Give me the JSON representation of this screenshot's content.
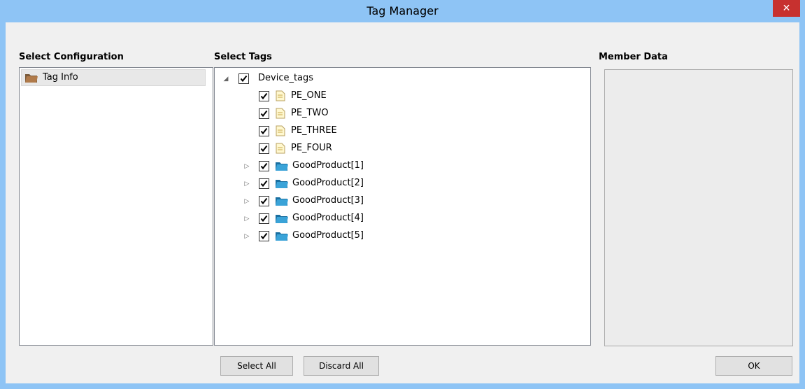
{
  "window": {
    "title": "Tag Manager",
    "close_glyph": "✕"
  },
  "labels": {
    "select_configuration": "Select Configuration",
    "select_tags": "Select Tags",
    "member_data": "Member Data"
  },
  "configuration": {
    "items": [
      {
        "label": "Tag Info",
        "icon": "folder-icon"
      }
    ]
  },
  "tree": {
    "root": {
      "label": "Device_tags",
      "expanded": true,
      "checked": true
    },
    "children": [
      {
        "label": "PE_ONE",
        "icon": "tag-document-icon",
        "checked": true
      },
      {
        "label": "PE_TWO",
        "icon": "tag-document-icon",
        "checked": true
      },
      {
        "label": "PE_THREE",
        "icon": "tag-document-icon",
        "checked": true
      },
      {
        "label": "PE_FOUR",
        "icon": "tag-document-icon",
        "checked": true
      },
      {
        "label": "GoodProduct[1]",
        "icon": "struct-folder-icon",
        "checked": true,
        "expandable": true
      },
      {
        "label": "GoodProduct[2]",
        "icon": "struct-folder-icon",
        "checked": true,
        "expandable": true
      },
      {
        "label": "GoodProduct[3]",
        "icon": "struct-folder-icon",
        "checked": true,
        "expandable": true
      },
      {
        "label": "GoodProduct[4]",
        "icon": "struct-folder-icon",
        "checked": true,
        "expandable": true
      },
      {
        "label": "GoodProduct[5]",
        "icon": "struct-folder-icon",
        "checked": true,
        "expandable": true
      }
    ]
  },
  "buttons": {
    "select_all": "Select All",
    "discard_all": "Discard All",
    "ok": "OK"
  },
  "colors": {
    "titlebar": "#8ec4f5",
    "close_button": "#c7312f",
    "client_bg": "#f0f0f0"
  }
}
